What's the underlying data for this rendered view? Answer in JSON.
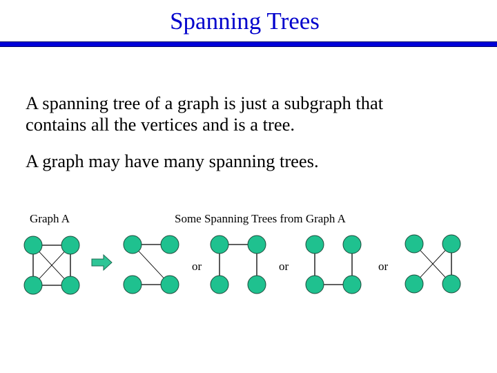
{
  "slide": {
    "title": "Spanning Trees",
    "paragraphs": [
      "A spanning tree of a graph is just a subgraph that",
      "contains all the vertices and is a tree.",
      "A graph may have many spanning trees."
    ],
    "graph_label": "Graph A",
    "trees_label": "Some Spanning Trees from Graph A",
    "separator": "or"
  },
  "colors": {
    "title": "#0000cc",
    "rule": "#0000d8",
    "node_fill": "#1fc18f",
    "arrow_fill": "#2ec596",
    "edge": "#000000"
  },
  "diagram": {
    "vertices": [
      "top-left",
      "top-right",
      "bottom-left",
      "bottom-right"
    ],
    "graphs": [
      {
        "name": "graph-a",
        "edges": [
          [
            "top-left",
            "top-right"
          ],
          [
            "bottom-left",
            "bottom-right"
          ],
          [
            "top-left",
            "bottom-left"
          ],
          [
            "top-right",
            "bottom-right"
          ],
          [
            "top-left",
            "bottom-right"
          ],
          [
            "top-right",
            "bottom-left"
          ]
        ]
      },
      {
        "name": "spanning-tree-1",
        "edges": [
          [
            "top-left",
            "top-right"
          ],
          [
            "top-left",
            "bottom-right"
          ],
          [
            "bottom-left",
            "bottom-right"
          ]
        ]
      },
      {
        "name": "spanning-tree-2",
        "edges": [
          [
            "top-left",
            "top-right"
          ],
          [
            "top-left",
            "bottom-left"
          ],
          [
            "top-right",
            "bottom-right"
          ]
        ]
      },
      {
        "name": "spanning-tree-3",
        "edges": [
          [
            "top-left",
            "bottom-left"
          ],
          [
            "bottom-left",
            "bottom-right"
          ],
          [
            "top-right",
            "bottom-right"
          ]
        ]
      },
      {
        "name": "spanning-tree-4",
        "edges": [
          [
            "top-left",
            "bottom-right"
          ],
          [
            "top-right",
            "bottom-left"
          ],
          [
            "top-right",
            "bottom-right"
          ]
        ]
      }
    ]
  }
}
